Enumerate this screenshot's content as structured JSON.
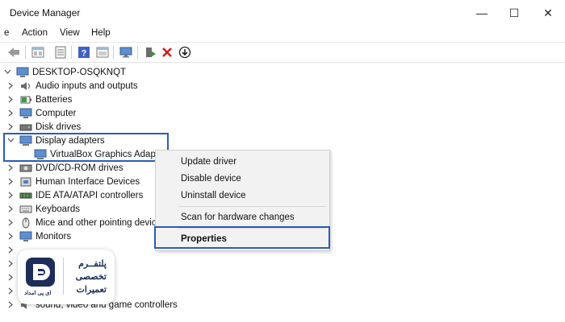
{
  "window": {
    "title": "Device Manager",
    "controls": {
      "minimize": "—",
      "maximize": "☐",
      "close": "✕"
    }
  },
  "menu": [
    "e",
    "Action",
    "View",
    "Help"
  ],
  "toolbar": {
    "icons": [
      "back-arrow-icon",
      "properties-icon",
      "device-list-icon",
      "help-icon",
      "action-icon",
      "monitor-icon",
      "update-driver-icon",
      "uninstall-icon",
      "download-icon"
    ]
  },
  "tree": {
    "root": "DESKTOP-OSQKNQT",
    "categories": [
      {
        "label": "Audio inputs and outputs",
        "icon": "speaker-icon"
      },
      {
        "label": "Batteries",
        "icon": "battery-icon"
      },
      {
        "label": "Computer",
        "icon": "computer-icon"
      },
      {
        "label": "Disk drives",
        "icon": "disk-icon"
      },
      {
        "label": "Display adapters",
        "icon": "display-adapter-icon",
        "expanded": true,
        "children": [
          "VirtualBox Graphics Adapt"
        ]
      },
      {
        "label": "DVD/CD-ROM drives",
        "icon": "dvd-icon"
      },
      {
        "label": "Human Interface Devices",
        "icon": "hid-icon"
      },
      {
        "label": "IDE ATA/ATAPI controllers",
        "icon": "ide-icon"
      },
      {
        "label": "Keyboards",
        "icon": "keyboard-icon"
      },
      {
        "label": "Mice and other pointing devic",
        "icon": "mouse-icon"
      },
      {
        "label": "Monitors",
        "icon": "monitor-icon"
      }
    ],
    "partial_bottom": "sound, video and game controllers"
  },
  "context_menu": {
    "items": [
      "Update driver",
      "Disable device",
      "Uninstall device",
      "Scan for hardware changes",
      "Properties"
    ]
  },
  "watermark": {
    "line1": "پلتفــرم",
    "line2": "تخصصی",
    "line3": "تعمیرات",
    "brand": "ای پی امداد"
  },
  "colors": {
    "highlight": "#2a5db3",
    "brand": "#1d2d5a"
  }
}
